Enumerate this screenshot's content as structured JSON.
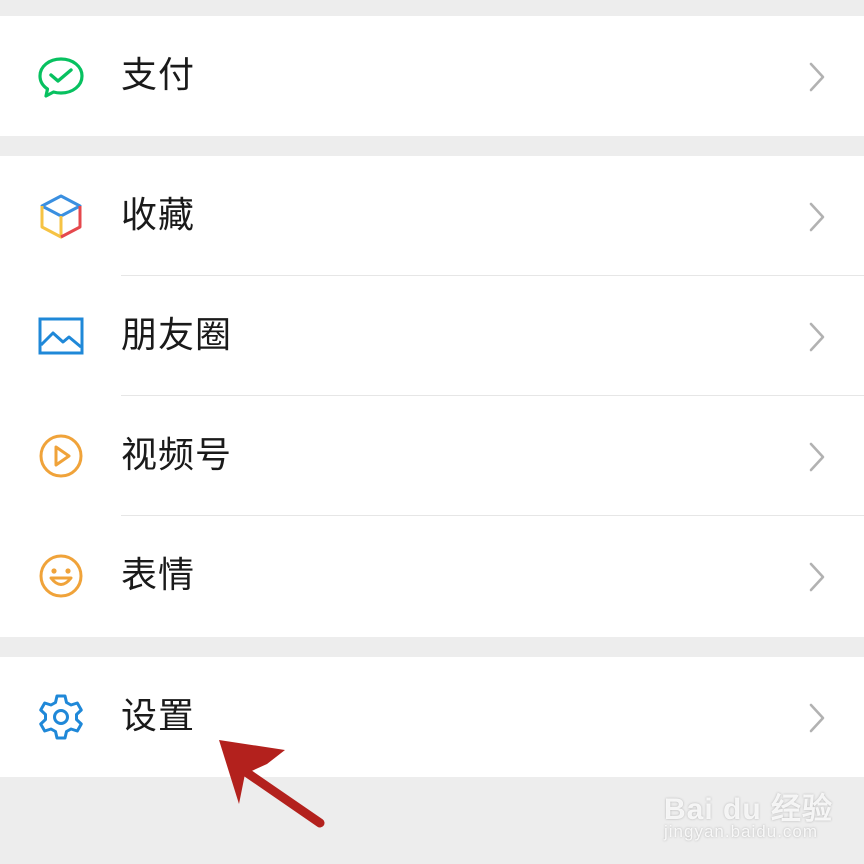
{
  "menu_groups": [
    {
      "items": [
        {
          "label": "支付",
          "icon": "wechat-pay-icon"
        }
      ]
    },
    {
      "items": [
        {
          "label": "收藏",
          "icon": "favorites-cube-icon"
        },
        {
          "label": "朋友圈",
          "icon": "moments-picture-icon"
        },
        {
          "label": "视频号",
          "icon": "channels-play-icon"
        },
        {
          "label": "表情",
          "icon": "sticker-smiley-icon"
        }
      ]
    },
    {
      "items": [
        {
          "label": "设置",
          "icon": "settings-gear-icon"
        }
      ]
    }
  ],
  "colors": {
    "pay_green": "#07c160",
    "blue": "#1f88d8",
    "orange": "#f0a33a",
    "cube_red": "#e5484d",
    "cube_yellow": "#f6c344",
    "cube_blue": "#3a8fe0",
    "annotation_arrow": "#b3211d"
  },
  "watermark": {
    "brand": "Bai du 经验",
    "url": "jingyan.baidu.com"
  }
}
